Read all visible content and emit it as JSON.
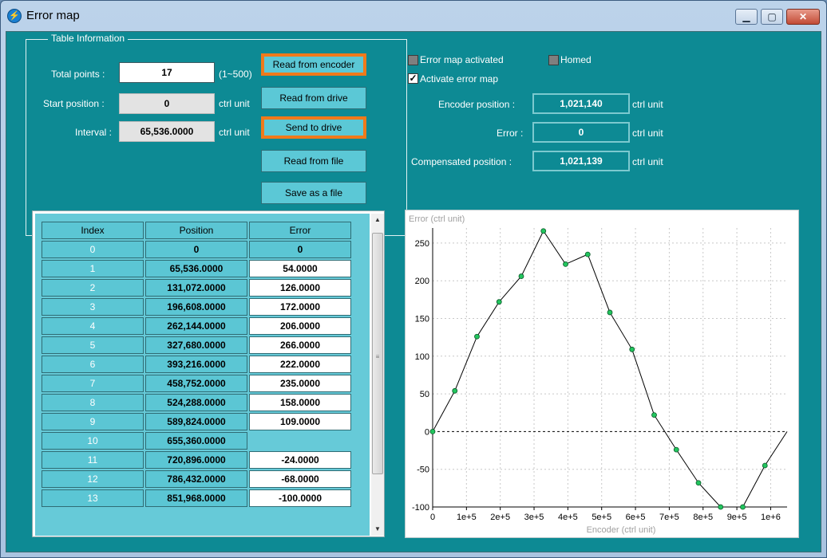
{
  "window": {
    "title": "Error map",
    "minimize": "▁",
    "maximize": "▢",
    "close": "✕"
  },
  "table_info": {
    "title": "Table Information",
    "total_points_label": "Total points :",
    "total_points": "17",
    "total_points_range": "(1~500)",
    "start_position_label": "Start position :",
    "start_position": "0",
    "start_position_unit": "ctrl unit",
    "interval_label": "Interval :",
    "interval": "65,536.0000",
    "interval_unit": "ctrl unit"
  },
  "buttons": {
    "read_encoder": "Read from encoder",
    "read_drive": "Read from drive",
    "send_drive": "Send to drive",
    "read_file": "Read from file",
    "save_file": "Save as a file"
  },
  "status": {
    "error_map_activated": "Error map activated",
    "homed": "Homed",
    "activate_error_map": "Activate error map",
    "activate_checked_mark": "✓",
    "encoder_position_label": "Encoder position :",
    "encoder_position": "1,021,140",
    "encoder_position_unit": "ctrl unit",
    "error_label": "Error :",
    "error": "0",
    "error_unit": "ctrl unit",
    "compensated_label": "Compensated position :",
    "compensated": "1,021,139",
    "compensated_unit": "ctrl unit"
  },
  "table": {
    "headers": [
      "Index",
      "Position",
      "Error"
    ],
    "rows": [
      [
        "0",
        "0",
        "0"
      ],
      [
        "1",
        "65,536.0000",
        "54.0000"
      ],
      [
        "2",
        "131,072.0000",
        "126.0000"
      ],
      [
        "3",
        "196,608.0000",
        "172.0000"
      ],
      [
        "4",
        "262,144.0000",
        "206.0000"
      ],
      [
        "5",
        "327,680.0000",
        "266.0000"
      ],
      [
        "6",
        "393,216.0000",
        "222.0000"
      ],
      [
        "7",
        "458,752.0000",
        "235.0000"
      ],
      [
        "8",
        "524,288.0000",
        "158.0000"
      ],
      [
        "9",
        "589,824.0000",
        "109.0000"
      ],
      [
        "10",
        "655,360.0000",
        ""
      ],
      [
        "11",
        "720,896.0000",
        "-24.0000"
      ],
      [
        "12",
        "786,432.0000",
        "-68.0000"
      ],
      [
        "13",
        "851,968.0000",
        "-100.0000"
      ]
    ]
  },
  "chart_data": {
    "type": "line",
    "ylabel": "Error (ctrl unit)",
    "xlabel": "Encoder (ctrl unit)",
    "x": [
      0,
      65536,
      131072,
      196608,
      262144,
      327680,
      393216,
      458752,
      524288,
      589824,
      655360,
      720896,
      786432,
      851968,
      917504,
      983040,
      1048576
    ],
    "y": [
      0,
      54,
      126,
      172,
      206,
      266,
      222,
      235,
      158,
      109,
      22,
      -24,
      -68,
      -100,
      -100,
      -45,
      0
    ],
    "xlim": [
      0,
      1048576
    ],
    "ylim": [
      -100,
      270
    ],
    "x_ticks": [
      0,
      100000,
      200000,
      300000,
      400000,
      500000,
      600000,
      700000,
      800000,
      900000,
      1000000
    ],
    "x_tick_labels": [
      "0",
      "1e+5",
      "2e+5",
      "3e+5",
      "4e+5",
      "5e+5",
      "6e+5",
      "7e+5",
      "8e+5",
      "9e+5",
      "1e+6"
    ],
    "y_ticks": [
      -100,
      -50,
      0,
      50,
      100,
      150,
      200,
      250
    ],
    "y_tick_labels": [
      "-100",
      "-50",
      "0",
      "50",
      "100",
      "150",
      "200",
      "250"
    ],
    "grid": true,
    "line_color": "#000000",
    "marker_color": "#22c55e"
  }
}
